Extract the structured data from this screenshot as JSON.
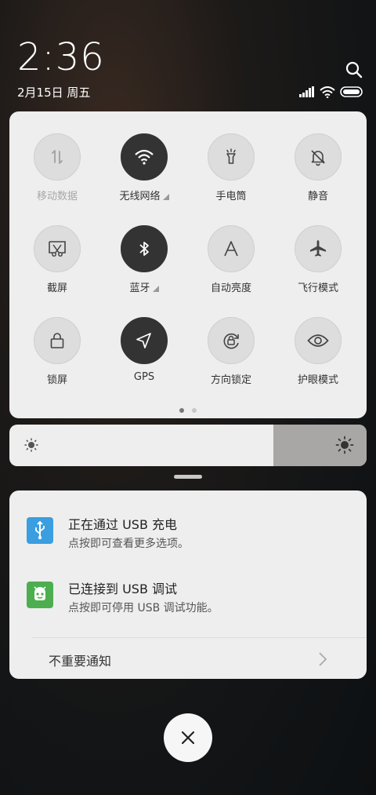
{
  "header": {
    "time": "2:36",
    "date": "2月15日 周五"
  },
  "quick_settings": {
    "tiles": [
      {
        "label": "移动数据",
        "icon": "mobile-data-icon",
        "active": false,
        "dim": true,
        "has_menu": false
      },
      {
        "label": "无线网络",
        "icon": "wifi-icon",
        "active": true,
        "dim": false,
        "has_menu": true
      },
      {
        "label": "手电筒",
        "icon": "flashlight-icon",
        "active": false,
        "dim": false,
        "has_menu": false
      },
      {
        "label": "静音",
        "icon": "bell-off-icon",
        "active": false,
        "dim": false,
        "has_menu": false
      },
      {
        "label": "截屏",
        "icon": "screenshot-icon",
        "active": false,
        "dim": false,
        "has_menu": false
      },
      {
        "label": "蓝牙",
        "icon": "bluetooth-icon",
        "active": true,
        "dim": false,
        "has_menu": true
      },
      {
        "label": "自动亮度",
        "icon": "auto-brightness-icon",
        "active": false,
        "dim": false,
        "has_menu": false
      },
      {
        "label": "飞行模式",
        "icon": "airplane-icon",
        "active": false,
        "dim": false,
        "has_menu": false
      },
      {
        "label": "锁屏",
        "icon": "lock-icon",
        "active": false,
        "dim": false,
        "has_menu": false
      },
      {
        "label": "GPS",
        "icon": "location-arrow-icon",
        "active": true,
        "dim": false,
        "has_menu": false
      },
      {
        "label": "方向锁定",
        "icon": "rotation-lock-icon",
        "active": false,
        "dim": false,
        "has_menu": false
      },
      {
        "label": "护眼模式",
        "icon": "eye-icon",
        "active": false,
        "dim": false,
        "has_menu": false
      }
    ],
    "page_count": 2,
    "current_page": 1
  },
  "brightness": {
    "level_percent": 74
  },
  "notifications": [
    {
      "title": "正在通过 USB 充电",
      "subtitle": "点按即可查看更多选项。",
      "icon": "usb-icon",
      "color": "#3a9ee0"
    },
    {
      "title": "已连接到 USB 调试",
      "subtitle": "点按即可停用 USB 调试功能。",
      "icon": "android-debug-icon",
      "color": "#4cae4f"
    }
  ],
  "minor_notifications_label": "不重要通知",
  "colors": {
    "panel_bg": "#eeeeee",
    "tile_active": "#333333",
    "tile_inactive": "#dddddd"
  }
}
